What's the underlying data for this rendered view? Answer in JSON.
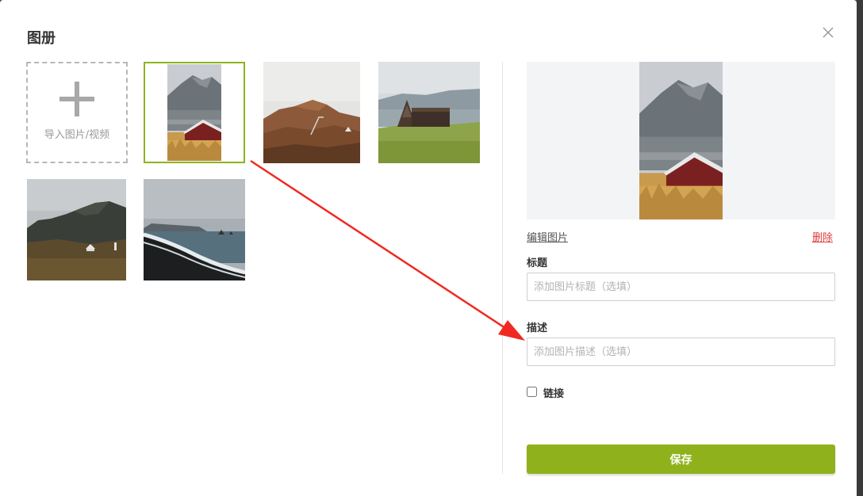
{
  "dialog": {
    "title": "图册",
    "close_icon": "close-icon"
  },
  "gallery": {
    "upload_label": "导入图片/视频",
    "upload_icon": "plus-icon",
    "selected_border_color": "#8fb21c",
    "images": [
      {
        "name": "mountain-red-cabin",
        "selected": true
      },
      {
        "name": "hills-cabin"
      },
      {
        "name": "a-frame-hut"
      },
      {
        "name": "cliff-coast-houses"
      },
      {
        "name": "black-sand-beach"
      }
    ]
  },
  "panel": {
    "edit_image_link": "编辑图片",
    "delete_link": "删除",
    "title_label": "标题",
    "title_value": "",
    "title_placeholder": "添加图片标题（选填）",
    "description_label": "描述",
    "description_value": "",
    "description_placeholder": "添加图片描述（选填）",
    "link_label": "链接",
    "link_checked": false,
    "save_label": "保存"
  },
  "colors": {
    "accent": "#8fb21c",
    "danger": "#e23b3b",
    "annotation_arrow": "#f02a22"
  }
}
